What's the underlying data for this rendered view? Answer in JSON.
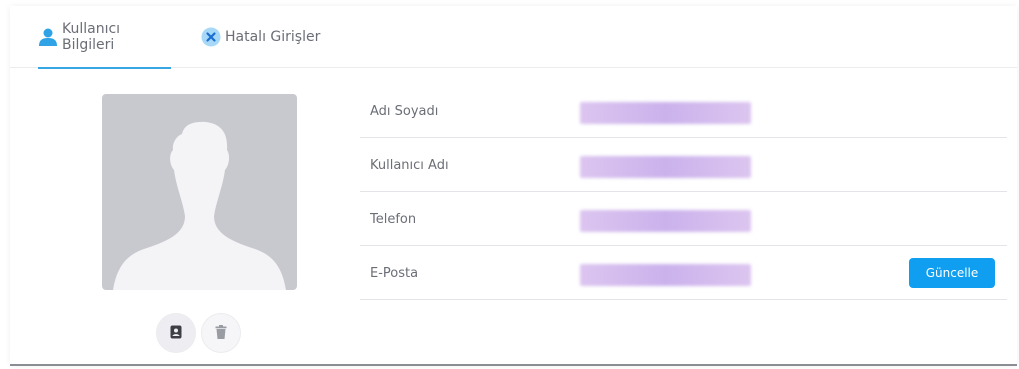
{
  "tabs": [
    {
      "label": "Kullanıcı Bilgileri",
      "icon": "user-icon",
      "active": true
    },
    {
      "label": "Hatalı Girişler",
      "icon": "close-circle-icon",
      "active": false
    }
  ],
  "profile": {
    "avatar": "avatar-placeholder-icon",
    "actions": [
      {
        "icon": "contact-card-icon"
      },
      {
        "icon": "trash-icon"
      }
    ]
  },
  "fields": [
    {
      "label": "Adı Soyadı",
      "value": ""
    },
    {
      "label": "Kullanıcı Adı",
      "value": ""
    },
    {
      "label": "Telefon",
      "value": ""
    },
    {
      "label": "E-Posta",
      "value": ""
    }
  ],
  "update_button": {
    "label": "Güncelle"
  },
  "colors": {
    "accent": "#37a6e2",
    "button": "#0f9ef0",
    "redacted": "#cbb2ec"
  }
}
